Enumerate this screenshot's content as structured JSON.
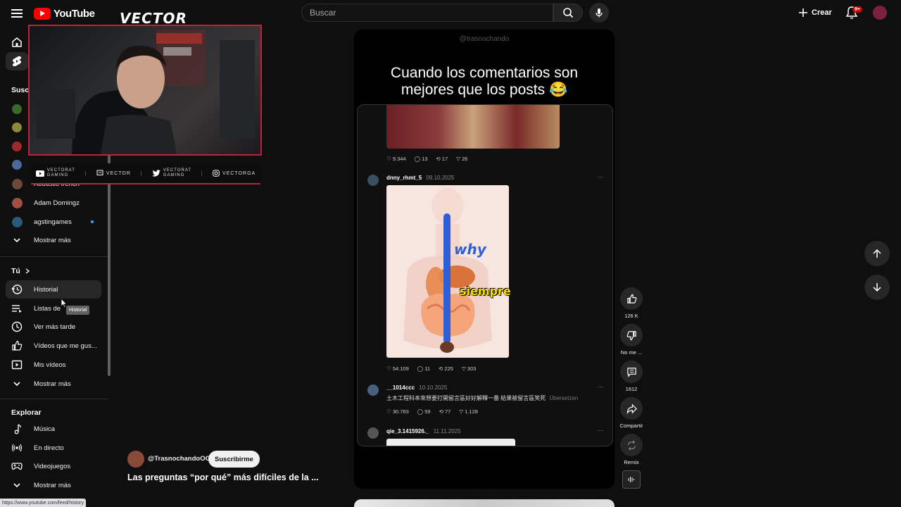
{
  "header": {
    "brand": "YouTube",
    "search_placeholder": "Buscar",
    "create_label": "Crear",
    "notification_badge": "9+"
  },
  "overlay": {
    "logo_text": "VECTOR",
    "socials": [
      {
        "icon": "youtube-icon",
        "label": "VECTORAT\nGAMING"
      },
      {
        "icon": "tv-icon",
        "label": "VECTOR"
      },
      {
        "icon": "twitter-icon",
        "label": "VECTORAT\nGAMING"
      },
      {
        "icon": "instagram-icon",
        "label": "VECTORGA"
      }
    ]
  },
  "sidebar": {
    "subs_heading": "Susc",
    "subscriptions": [
      {
        "label": "Acoustic french",
        "color": "#6a4a3a"
      },
      {
        "label": "Adam Domingz",
        "color": "#a05040"
      },
      {
        "label": "agstingames",
        "color": "#2a5a7a"
      }
    ],
    "show_more": "Mostrar más",
    "you_heading": "Tú",
    "you_items": [
      {
        "label": "Historial",
        "icon": "history-icon"
      },
      {
        "label": "Listas de",
        "icon": "playlists-icon"
      },
      {
        "label": "Ver más tarde",
        "icon": "watch-later-icon"
      },
      {
        "label": "Vídeos que me gus...",
        "icon": "like-icon"
      },
      {
        "label": "Mis vídeos",
        "icon": "my-videos-icon"
      },
      {
        "label": "Mostrar más",
        "icon": "chevron-down-icon"
      }
    ],
    "explore_heading": "Explorar",
    "explore_items": [
      {
        "label": "Música",
        "icon": "music-icon"
      },
      {
        "label": "En directo",
        "icon": "live-icon"
      },
      {
        "label": "Videojuegos",
        "icon": "gaming-icon"
      },
      {
        "label": "Mostrar más",
        "icon": "chevron-down-icon"
      }
    ],
    "tooltip": "Historial"
  },
  "short": {
    "watermark": "@trasnochando",
    "headline_line1": "Cuando los comentarios son",
    "headline_line2": "mejores que los posts",
    "headline_emoji": "😂",
    "posts": [
      {
        "likes": "9.344",
        "comments": "13",
        "reposts": "17",
        "shares": "26"
      },
      {
        "user": "dnny_rhmt_5",
        "date": "09.10.2025",
        "image_caption": "siempre",
        "likes": "54.109",
        "comments": "11",
        "reposts": "225",
        "shares": "303"
      },
      {
        "user": "__1014ccc",
        "date": "10.10.2025",
        "text": "土木工程科本來想要打開留言區好好解釋一番 結果被留言區笑死",
        "translate": "Übersetzen",
        "likes": "30.783",
        "comments": "59",
        "reposts": "77",
        "shares": "1.128"
      },
      {
        "user": "qie_3.1415926._",
        "date": "11.11.2025"
      }
    ],
    "channel": "@TrasnochandoOG",
    "subscribe_label": "Suscribirme",
    "title": "Las preguntas “por qué” más difíciles de la ..."
  },
  "actions": {
    "likes": "126 K",
    "dislike": "No me ...",
    "comments": "1612",
    "share": "Compartir",
    "remix": "Remix"
  },
  "status_url": "https://www.youtube.com/feed/history"
}
